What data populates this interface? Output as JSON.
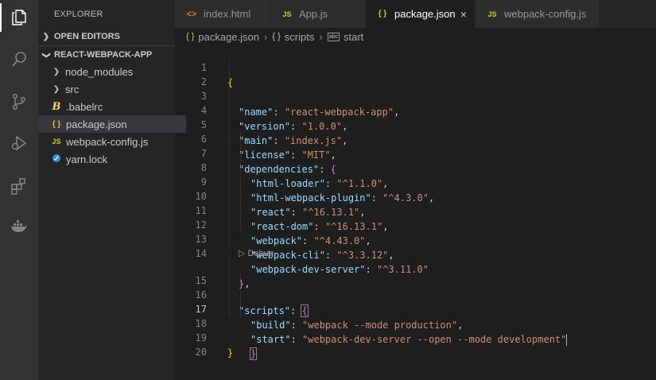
{
  "sidebar": {
    "title": "EXPLORER",
    "open_editors": "OPEN EDITORS",
    "project": "REACT-WEBPACK-APP",
    "items": [
      {
        "label": "node_modules",
        "icon": "chevron-right-icon"
      },
      {
        "label": "src",
        "icon": "chevron-right-icon"
      },
      {
        "label": ".babelrc",
        "icon": "babel-icon"
      },
      {
        "label": "package.json",
        "icon": "json-icon",
        "glyph": "{ }"
      },
      {
        "label": "webpack-config.js",
        "icon": "js-icon",
        "glyph": "JS"
      },
      {
        "label": "yarn.lock",
        "icon": "yarn-icon"
      }
    ]
  },
  "tabs": [
    {
      "label": "index.html",
      "glyph": "<>"
    },
    {
      "label": "App.js",
      "glyph": "JS"
    },
    {
      "label": "package.json",
      "glyph": "{ }",
      "close": "×"
    },
    {
      "label": "webpack-config.js",
      "glyph": "JS"
    }
  ],
  "breadcrumb": {
    "file": "package.json",
    "section": "scripts",
    "leaf": "start",
    "file_glyph": "{ }",
    "section_glyph": "{ }",
    "leaf_glyph": "abc"
  },
  "editor": {
    "codelens": "▷ Debug",
    "line_numbers": [
      "1",
      "2",
      "3",
      "4",
      "5",
      "6",
      "7",
      "8",
      "9",
      "10",
      "11",
      "12",
      "13",
      "14",
      "15",
      "16",
      "17",
      "18",
      "19",
      "20"
    ],
    "lines": {
      "l1": "{",
      "l2_k": "\"name\"",
      "l2_v": "\"react-webpack-app\"",
      "l3_k": "\"version\"",
      "l3_v": "\"1.0.0\"",
      "l4_k": "\"main\"",
      "l4_v": "\"index.js\"",
      "l5_k": "\"license\"",
      "l5_v": "\"MIT\"",
      "l6_k": "\"dependencies\"",
      "l6_b": "{",
      "l7_k": "\"html-loader\"",
      "l7_v": "\"^1.1.0\"",
      "l8_k": "\"html-webpack-plugin\"",
      "l8_v": "\"^4.3.0\"",
      "l9_k": "\"react\"",
      "l9_v": "\"^16.13.1\"",
      "l10_k": "\"react-dom\"",
      "l10_v": "\"^16.13.1\"",
      "l11_k": "\"webpack\"",
      "l11_v": "\"^4.43.0\"",
      "l12_k": "\"webpack-cli\"",
      "l12_v": "\"^3.3.12\"",
      "l13_k": "\"webpack-dev-server\"",
      "l13_v": "\"^3.11.0\"",
      "l14_b": "}",
      "l15_k": "\"scripts\"",
      "l15_b": "{",
      "l16_k": "\"build\"",
      "l16_v": "\"webpack --mode production\"",
      "l17_k": "\"start\"",
      "l17_v": "\"webpack-dev-server --open --mode development\"",
      "l18_b": "}",
      "l19": "}"
    }
  },
  "colors": {
    "activity_bar": "#333333",
    "sidebar": "#252526",
    "editor": "#1e1e1e",
    "key": "#9cdcfe",
    "string": "#ce9178",
    "bracket_gold": "#ffd700",
    "bracket_purple": "#da70d6"
  }
}
